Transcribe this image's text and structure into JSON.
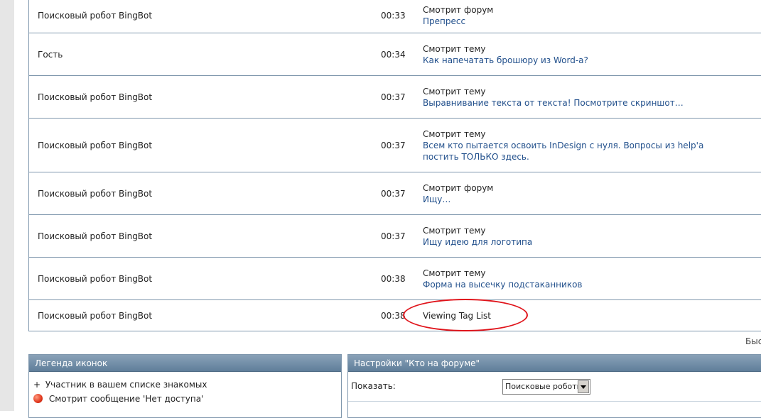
{
  "online_rows": [
    {
      "user": "Поисковый робот BingBot",
      "time": "00:33",
      "action": "Смотрит форум",
      "target": "Препресс"
    },
    {
      "user": "Гость",
      "time": "00:34",
      "action": "Смотрит тему",
      "target": "Как напечатать брошюру из Word-a?"
    },
    {
      "user": "Поисковый робот BingBot",
      "time": "00:37",
      "action": "Смотрит тему",
      "target": "Выравнивание текста от текста! Посмотрите скриншот…"
    },
    {
      "user": "Поисковый робот BingBot",
      "time": "00:37",
      "action": "Смотрит тему",
      "target": "Всем кто пытается освоить InDesign с нуля. Вопросы из help'а постить ТОЛЬКО здесь."
    },
    {
      "user": "Поисковый робот BingBot",
      "time": "00:37",
      "action": "Смотрит форум",
      "target": "Ищу…"
    },
    {
      "user": "Поисковый робот BingBot",
      "time": "00:37",
      "action": "Смотрит тему",
      "target": "Ищу идею для логотипа"
    },
    {
      "user": "Поисковый робот BingBot",
      "time": "00:38",
      "action": "Смотрит тему",
      "target": "Форма на высечку подстаканников"
    },
    {
      "user": "Поисковый робот BingBot",
      "time": "00:38",
      "action": "Viewing Tag List",
      "target": ""
    }
  ],
  "clipped_text": "Быс",
  "legend": {
    "title": "Легенда иконок",
    "items": [
      {
        "symbol": "+",
        "label": "Участник в вашем списке знакомых",
        "icon": "plus-icon"
      },
      {
        "symbol": "",
        "label": "Смотрит сообщение 'Нет доступа'",
        "icon": "red-dot-icon"
      }
    ]
  },
  "settings": {
    "title": "Настройки \"Кто на форуме\"",
    "show_label": "Показать:",
    "show_value": "Поисковые роботы"
  },
  "colors": {
    "accent_link": "#22508c",
    "border": "#7f97ad",
    "annotation_circle": "#e0141b"
  }
}
